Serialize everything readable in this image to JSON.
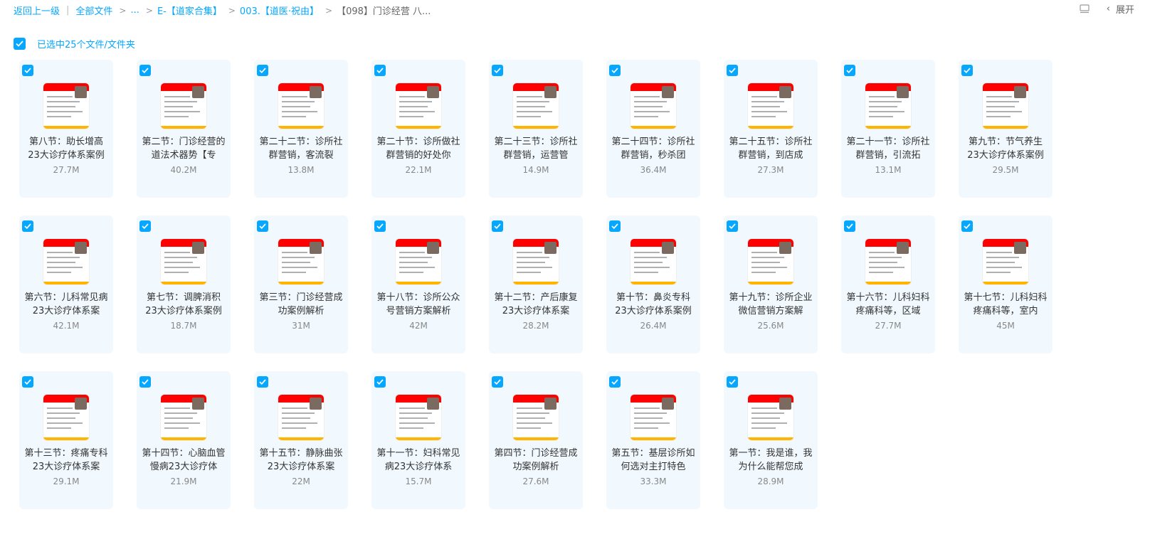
{
  "breadcrumb": {
    "back": "返回上一级",
    "all_files": "全部文件",
    "ellipsis": "...",
    "folder1": "E-【道家合集】",
    "folder2": "003.【道医·祝由】",
    "current": "【098】门诊经营 八..."
  },
  "toolbar": {
    "grid_icon": "grid-view-icon",
    "expand_label": "展开"
  },
  "selection": {
    "text": "已选中25个文件/文件夹"
  },
  "colors": {
    "accent": "#06a7ff",
    "card_bg": "#f1f9ff",
    "thumb_banner": "#ff0000",
    "thumb_footer": "#ffb400"
  },
  "files": [
    {
      "name": "第八节：助长增高23大诊疗体系案例",
      "size": "27.7M"
    },
    {
      "name": "第二节：门诊经营的道法术器势【专",
      "size": "40.2M"
    },
    {
      "name": "第二十二节：诊所社群营销，客流裂",
      "size": "13.8M"
    },
    {
      "name": "第二十节：诊所做社群营销的好处你",
      "size": "22.1M"
    },
    {
      "name": "第二十三节：诊所社群营销，运营管",
      "size": "14.9M"
    },
    {
      "name": "第二十四节：诊所社群营销，秒杀团",
      "size": "36.4M"
    },
    {
      "name": "第二十五节：诊所社群营销，到店成",
      "size": "27.3M"
    },
    {
      "name": "第二十一节：诊所社群营销，引流拓",
      "size": "13.1M"
    },
    {
      "name": "第九节：节气养生23大诊疗体系案例",
      "size": "29.5M"
    },
    {
      "name": "第六节：儿科常见病23大诊疗体系案",
      "size": "42.1M"
    },
    {
      "name": "第七节：调脾消积23大诊疗体系案例",
      "size": "18.7M"
    },
    {
      "name": "第三节：门诊经营成功案例解析",
      "size": "31M"
    },
    {
      "name": "第十八节：诊所公众号营销方案解析",
      "size": "42M"
    },
    {
      "name": "第十二节：产后康复23大诊疗体系案",
      "size": "28.2M"
    },
    {
      "name": "第十节：鼻炎专科23大诊疗体系案例",
      "size": "26.4M"
    },
    {
      "name": "第十九节：诊所企业微信营销方案解",
      "size": "25.6M"
    },
    {
      "name": "第十六节：儿科妇科疼痛科等，区域",
      "size": "27.7M"
    },
    {
      "name": "第十七节：儿科妇科疼痛科等，室内",
      "size": "45M"
    },
    {
      "name": "第十三节：疼痛专科23大诊疗体系案",
      "size": "29.1M"
    },
    {
      "name": "第十四节：心脑血管慢病23大诊疗体",
      "size": "21.9M"
    },
    {
      "name": "第十五节：静脉曲张23大诊疗体系案",
      "size": "22M"
    },
    {
      "name": "第十一节：妇科常见病23大诊疗体系",
      "size": "15.7M"
    },
    {
      "name": "第四节：门诊经营成功案例解析",
      "size": "27.6M"
    },
    {
      "name": "第五节：基层诊所如何选对主打特色",
      "size": "33.3M"
    },
    {
      "name": "第一节：我是谁，我为什么能帮您成",
      "size": "28.9M"
    }
  ]
}
